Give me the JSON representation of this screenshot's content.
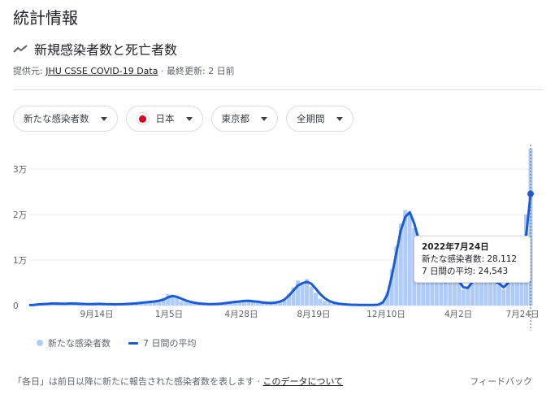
{
  "page_title": "統計情報",
  "section_title": "新規感染者数と死亡者数",
  "source": {
    "prefix": "提供元: ",
    "link": "JHU CSSE COVID-19 Data",
    "suffix": " · 最終更新: 2 日前"
  },
  "filters": [
    {
      "label": "新たな感染者数"
    },
    {
      "label": "日本",
      "flag": "japan"
    },
    {
      "label": "東京都"
    },
    {
      "label": "全期間"
    }
  ],
  "colors": {
    "line": "#1a5cd8",
    "bars": "#aecbfa",
    "grid": "#e8eaed"
  },
  "tooltip": {
    "date": "2022年7月24日",
    "cases_line": "新たな感染者数: 28,112",
    "avg_line": "7 日間の平均: 24,543"
  },
  "legend": {
    "bars": "新たな感染者数",
    "line": "7 日間の平均"
  },
  "footer": {
    "note": "「各日」は前日以降に新たに報告された感染者数を表します · ",
    "link": "このデータについて",
    "feedback": "フィードバック"
  },
  "chart_data": {
    "type": "area",
    "x_ticks": [
      "9月14日",
      "1月5日",
      "4月28日",
      "8月19日",
      "12月10日",
      "4月2日",
      "7月24日"
    ],
    "y_ticks": [
      "0",
      "1万",
      "2万",
      "3万"
    ],
    "ylim": [
      0,
      35000
    ],
    "series": [
      {
        "name": "新たな感染者数",
        "type": "bars",
        "values": [
          100,
          200,
          350,
          250,
          500,
          650,
          450,
          300,
          400,
          600,
          500,
          350,
          300,
          250,
          300,
          450,
          400,
          300,
          250,
          250,
          300,
          350,
          400,
          500,
          600,
          700,
          800,
          900,
          1000,
          1200,
          1700,
          2500,
          2300,
          1600,
          1000,
          800,
          600,
          500,
          400,
          350,
          300,
          300,
          400,
          500,
          650,
          800,
          900,
          1000,
          1100,
          1100,
          900,
          800,
          600,
          500,
          500,
          700,
          900,
          1500,
          2600,
          4000,
          5500,
          4600,
          5800,
          4200,
          2800,
          1500,
          1000,
          700,
          400,
          300,
          200,
          200,
          150,
          150,
          150,
          100,
          100,
          150,
          200,
          900,
          3000,
          8000,
          13000,
          18000,
          21000,
          20000,
          17000,
          13000,
          11000,
          9000,
          7000,
          6000,
          5000,
          5500,
          7000,
          6500,
          5000,
          3500,
          4000,
          6000,
          8500,
          7500,
          6000,
          5000,
          5500,
          4500,
          3500,
          6000,
          9000,
          12000,
          15000,
          20000,
          34500
        ]
      },
      {
        "name": "7 日間の平均",
        "type": "line",
        "values": [
          100,
          150,
          250,
          300,
          350,
          450,
          450,
          400,
          400,
          450,
          450,
          400,
          350,
          300,
          300,
          350,
          350,
          300,
          280,
          270,
          280,
          300,
          350,
          420,
          500,
          600,
          700,
          800,
          900,
          1050,
          1300,
          1800,
          2100,
          1900,
          1500,
          1100,
          800,
          600,
          450,
          380,
          330,
          320,
          360,
          430,
          550,
          680,
          800,
          900,
          1000,
          1050,
          950,
          850,
          700,
          600,
          560,
          650,
          850,
          1300,
          2200,
          3300,
          4400,
          4900,
          5200,
          4800,
          3700,
          2500,
          1600,
          1000,
          650,
          420,
          300,
          230,
          180,
          160,
          150,
          130,
          120,
          140,
          200,
          700,
          2400,
          6500,
          11500,
          16500,
          19500,
          20500,
          18000,
          14500,
          11800,
          9800,
          7800,
          6300,
          5300,
          5200,
          6200,
          6300,
          5300,
          4000,
          3900,
          5200,
          7300,
          7800,
          6600,
          5500,
          5300,
          4800,
          4000,
          5000,
          7000,
          10000,
          12800,
          15500,
          24543
        ]
      }
    ],
    "highlight": {
      "x": "7月24日",
      "value": 24543
    }
  }
}
